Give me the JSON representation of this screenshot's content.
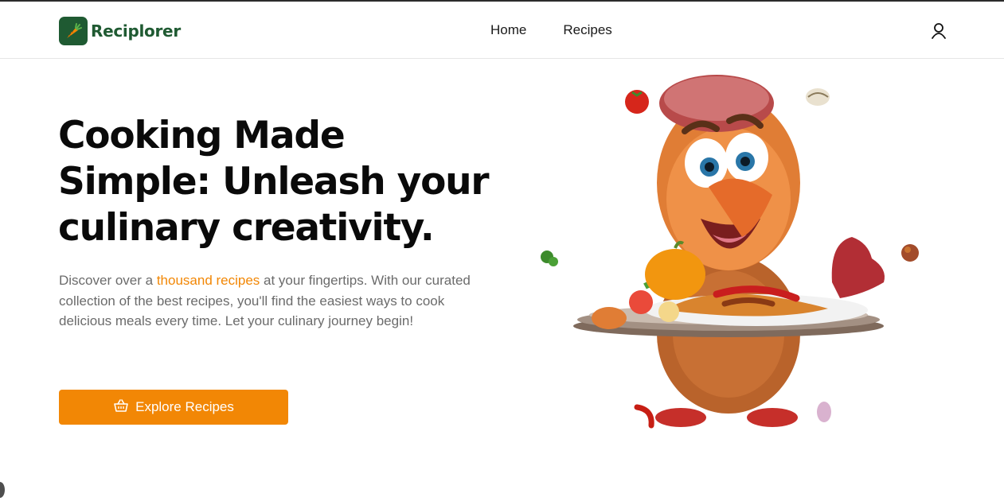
{
  "header": {
    "brand": "Reciplorer",
    "nav": [
      {
        "label": "Home"
      },
      {
        "label": "Recipes"
      }
    ],
    "user_icon": "user-icon"
  },
  "hero": {
    "title": "Cooking Made Simple: Unleash your culinary creativity.",
    "description_pre": "Discover over a ",
    "description_highlight": "thousand recipes",
    "description_post": " at your fingertips. With our curated collection of the best recipes, you'll find the easiest ways to cook delicious meals every time. Let your culinary journey begin!",
    "cta_label": "Explore Recipes",
    "cta_icon": "basket-icon"
  },
  "colors": {
    "brand_green": "#1f5a32",
    "accent_orange": "#f28705",
    "text_dark": "#0a0a0a",
    "text_muted": "#6b6b6b"
  }
}
